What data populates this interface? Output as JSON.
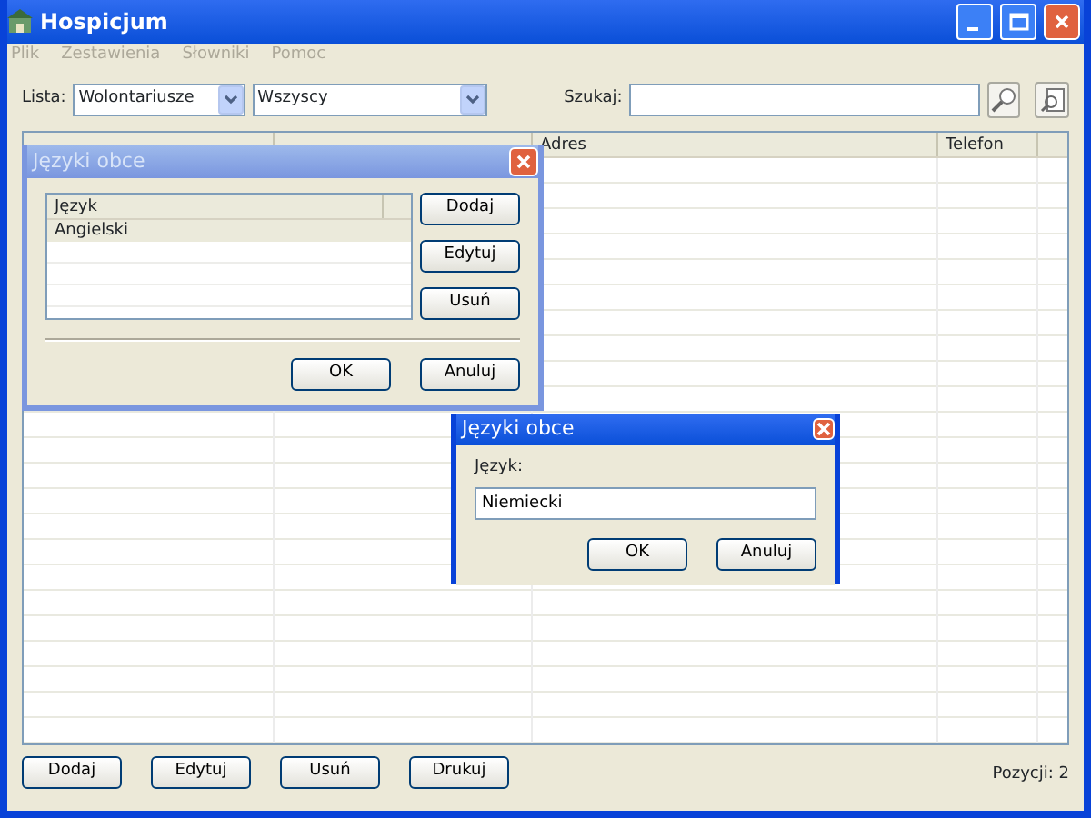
{
  "window": {
    "title": "Hospicjum"
  },
  "menu": [
    {
      "label": "Plik",
      "disabled": true
    },
    {
      "label": "Zestawienia",
      "disabled": true
    },
    {
      "label": "Słowniki",
      "disabled": true
    },
    {
      "label": "Pomoc",
      "disabled": true
    }
  ],
  "filter": {
    "label": "Lista:",
    "list": "Wolontariusze",
    "scope": "Wszyscy",
    "search_label": "Szukaj:"
  },
  "table": {
    "columns": [
      "",
      "",
      "Adres",
      "Telefon"
    ]
  },
  "buttons": [
    "Dodaj",
    "Edytuj",
    "Usuń",
    "Drukuj"
  ],
  "count": "Pozycji: 2",
  "dialogs": [
    {
      "kind": "list",
      "title": "Języki obce",
      "active": false,
      "column": "Język",
      "rows": [
        {
          "text": "Angielski",
          "selected": true
        }
      ],
      "side_buttons": [
        "Dodaj",
        "Edytuj",
        "Usuń"
      ],
      "buttons": [
        "OK",
        "Anuluj"
      ]
    },
    {
      "kind": "edit",
      "title": "Języki obce",
      "active": true,
      "label": "Język:",
      "value": "Niemiecki",
      "buttons": [
        "OK",
        "Anuluj"
      ]
    }
  ]
}
